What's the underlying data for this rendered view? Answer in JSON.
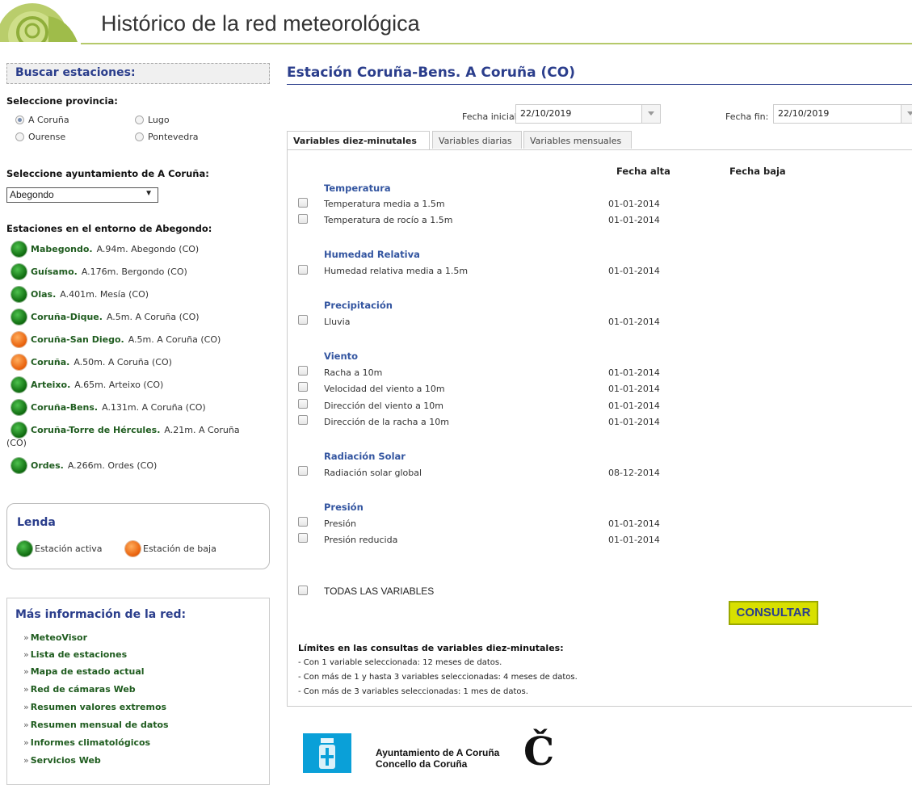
{
  "header": {
    "title": "Histórico de la red meteorológica"
  },
  "sidebar": {
    "search_title": "Buscar estaciones:",
    "province_label": "Seleccione provincia:",
    "provinces": [
      {
        "label": "A Coruña",
        "selected": true
      },
      {
        "label": "Lugo",
        "selected": false
      },
      {
        "label": "Ourense",
        "selected": false
      },
      {
        "label": "Pontevedra",
        "selected": false
      }
    ],
    "ayuntamiento_label": "Seleccione ayuntamiento de  A Coruña:",
    "ayuntamiento_value": "Abegondo",
    "stations_label": "Estaciones en el entorno de Abegondo:",
    "stations": [
      {
        "name": "Mabegondo.",
        "info": "A.94m. Abegondo (CO)",
        "status": "active"
      },
      {
        "name": "Guísamo.",
        "info": "A.176m. Bergondo (CO)",
        "status": "active"
      },
      {
        "name": "Olas.",
        "info": "A.401m. Mesía (CO)",
        "status": "active"
      },
      {
        "name": "Coruña-Dique.",
        "info": "A.5m. A Coruña (CO)",
        "status": "active"
      },
      {
        "name": "Coruña-San Diego.",
        "info": "A.5m. A Coruña (CO)",
        "status": "inactive"
      },
      {
        "name": "Coruña.",
        "info": "A.50m. A Coruña (CO)",
        "status": "inactive"
      },
      {
        "name": "Arteixo.",
        "info": "A.65m. Arteixo (CO)",
        "status": "active"
      },
      {
        "name": "Coruña-Bens.",
        "info": "A.131m. A Coruña (CO)",
        "status": "active"
      },
      {
        "name": "Coruña-Torre de Hércules.",
        "info": "A.21m. A Coruña",
        "info2": "(CO)",
        "status": "active"
      },
      {
        "name": "Ordes.",
        "info": "A.266m. Ordes (CO)",
        "status": "active"
      }
    ],
    "legend": {
      "title": "Lenda",
      "active": "Estación activa",
      "inactive": "Estación de baja"
    },
    "more": {
      "title": "Más información de la red:",
      "links": [
        "MeteoVisor",
        "Lista de estaciones",
        "Mapa de estado actual",
        "Red de cámaras Web",
        "Resumen valores extremos",
        "Resumen mensual de datos",
        "Informes climatológicos",
        "Servicios Web"
      ]
    }
  },
  "main": {
    "station_title": "Estación  Coruña-Bens. A Coruña (CO)",
    "fecha_inicial_label": "Fecha inicial:",
    "fecha_inicial_value": "22/10/2019",
    "fecha_fin_label": "Fecha fin:",
    "fecha_fin_value": "22/10/2019",
    "tabs": [
      "Variables diez-minutales",
      "Variables diarias",
      "Variables mensuales"
    ],
    "col_alta": "Fecha alta",
    "col_baja": "Fecha baja",
    "groups": [
      {
        "title": "Temperatura",
        "vars": [
          {
            "label": "Temperatura media a 1.5m",
            "alta": "01-01-2014"
          },
          {
            "label": "Temperatura de rocío a 1.5m",
            "alta": "01-01-2014"
          }
        ]
      },
      {
        "title": "Humedad Relativa",
        "vars": [
          {
            "label": "Humedad relativa media a 1.5m",
            "alta": "01-01-2014"
          }
        ]
      },
      {
        "title": "Precipitación",
        "vars": [
          {
            "label": "Lluvia",
            "alta": "01-01-2014"
          }
        ]
      },
      {
        "title": "Viento",
        "vars": [
          {
            "label": "Racha a 10m",
            "alta": "01-01-2014"
          },
          {
            "label": "Velocidad del viento a 10m",
            "alta": "01-01-2014"
          },
          {
            "label": "Dirección del viento a 10m",
            "alta": "01-01-2014"
          },
          {
            "label": "Dirección de la racha a 10m",
            "alta": "01-01-2014"
          }
        ]
      },
      {
        "title": "Radiación Solar",
        "vars": [
          {
            "label": "Radiación solar global",
            "alta": "08-12-2014"
          }
        ]
      },
      {
        "title": "Presión",
        "vars": [
          {
            "label": "Presión",
            "alta": "01-01-2014"
          },
          {
            "label": "Presión reducida",
            "alta": "01-01-2014"
          }
        ]
      }
    ],
    "all_vars_label": "TODAS LAS VARIABLES",
    "consult_button": "CONSULTAR",
    "limits_title": "Límites en las consultas de variables diez-minutales:",
    "limits": [
      "- Con 1 variable seleccionada: 12 meses de datos.",
      "- Con más de 1 y hasta 3 variables seleccionadas: 4 meses de datos.",
      "- Con más de 3 variables seleccionadas: 1 mes de datos."
    ]
  },
  "footer": {
    "org_line1": "Ayuntamiento de A Coruña",
    "org_line2": "Concello da Coruña",
    "brand_glyph": "Č"
  },
  "colors": {
    "brand_blue": "#2b3e8c",
    "station_green": "#1f5c1f",
    "consult_yellow": "#d8e000",
    "header_line": "#b5c96a"
  }
}
